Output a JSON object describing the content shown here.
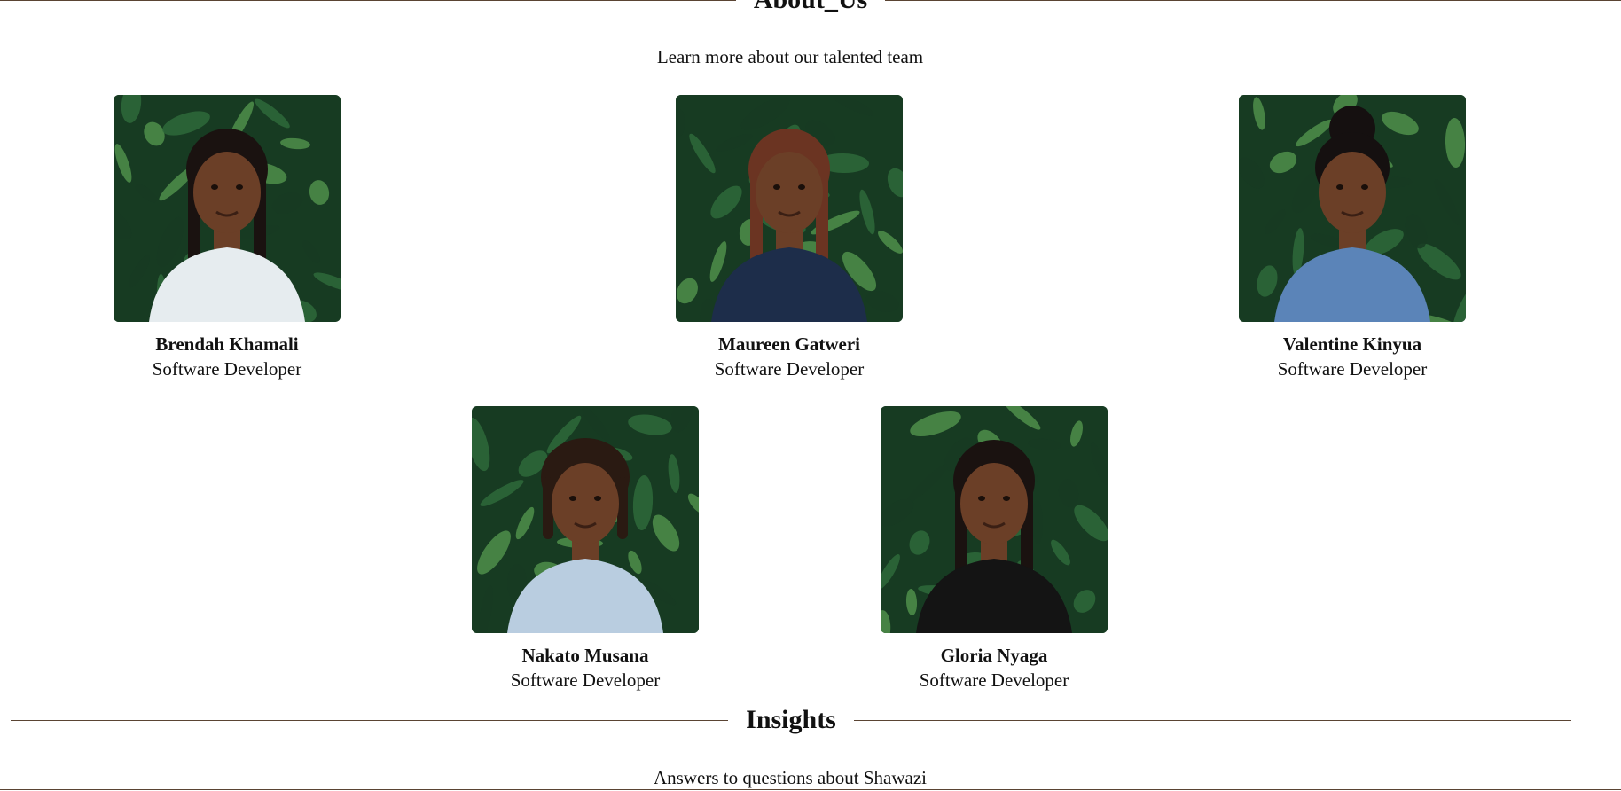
{
  "about": {
    "title": "About_Us",
    "subtitle": "Learn more about our talented team"
  },
  "team": [
    {
      "name": "Brendah Khamali",
      "role": "Software Developer",
      "shirt": "#e6ecef",
      "hair": "braids"
    },
    {
      "name": "Maureen Gatweri",
      "role": "Software Developer",
      "shirt": "#1d2d4a",
      "hair": "braids-red"
    },
    {
      "name": "Valentine Kinyua",
      "role": "Software Developer",
      "shirt": "#5b84b8",
      "hair": "bun"
    },
    {
      "name": "Nakato Musana",
      "role": "Software Developer",
      "shirt": "#b9cde0",
      "hair": "locs"
    },
    {
      "name": "Gloria Nyaga",
      "role": "Software Developer",
      "shirt": "#141414",
      "hair": "braids"
    }
  ],
  "insights": {
    "title": "Insights",
    "subtitle": "Answers to questions about Shawazi"
  },
  "colors": {
    "rule": "#5a4433",
    "foliage_dark": "#173b22",
    "foliage_mid": "#2e6a3a",
    "foliage_light": "#4f8f4a",
    "skin": "#6b3f27"
  }
}
